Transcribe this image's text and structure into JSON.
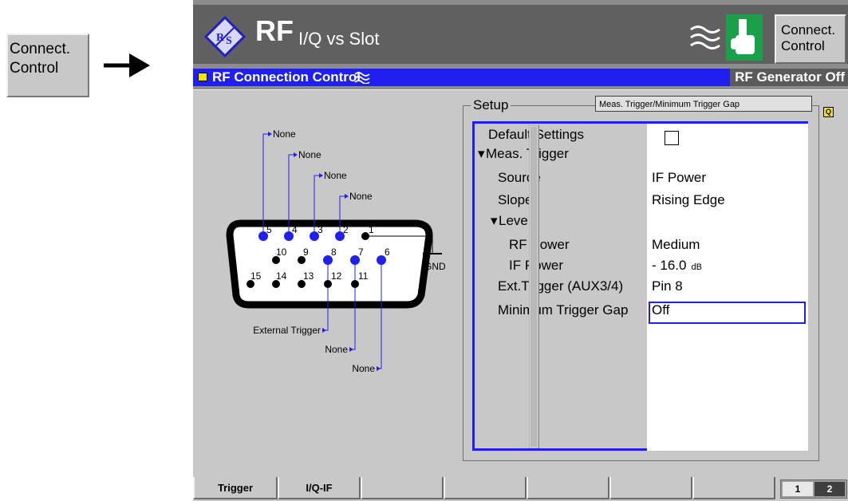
{
  "external": {
    "button_line1": "Connect.",
    "button_line2": "Control"
  },
  "title": {
    "main": "RF",
    "sub": "I/Q vs Slot"
  },
  "connect_button": {
    "line1": "Connect.",
    "line2": "Control"
  },
  "menubar": {
    "title": "RF Connection Control",
    "status": "RF Generator Off"
  },
  "setup": {
    "label": "Setup",
    "hint": "Meas. Trigger/Minimum Trigger Gap",
    "corner_icon": "Q",
    "rows": [
      {
        "label": "Default Settings",
        "value": ""
      },
      {
        "label": "Meas. Trigger",
        "value": ""
      },
      {
        "label": "Source",
        "value": "IF Power"
      },
      {
        "label": "Slope",
        "value": "Rising Edge"
      },
      {
        "label": "Level",
        "value": ""
      },
      {
        "label": "RF Power",
        "value": "Medium"
      },
      {
        "label": "IF Power",
        "value": "- 16.0",
        "unit": "dB"
      },
      {
        "label": "Ext.Trigger (AUX3/4)",
        "value": "Pin 8"
      },
      {
        "label": "Minimum Trigger Gap",
        "value": "Off"
      }
    ]
  },
  "connector": {
    "pin_numbers": [
      "5",
      "4",
      "3",
      "2",
      "1",
      "10",
      "9",
      "8",
      "7",
      "6",
      "15",
      "14",
      "13",
      "12",
      "11"
    ],
    "top_labels": [
      "None",
      "None",
      "None",
      "None"
    ],
    "bottom_labels": [
      "External Trigger",
      "None",
      "None"
    ],
    "ground_label": "GND"
  },
  "tabs": [
    {
      "label": "Trigger"
    },
    {
      "label": "I/Q-IF"
    },
    {
      "label": ""
    },
    {
      "label": ""
    },
    {
      "label": ""
    },
    {
      "label": ""
    },
    {
      "label": ""
    }
  ],
  "pager": {
    "page1": "1",
    "page2": "2"
  },
  "colors": {
    "accent_blue": "#1f1ff0",
    "panel_gray": "#c8c8c8",
    "title_gray": "#606060",
    "hand_green": "#1aa04a",
    "indicator_yellow": "#f2e400"
  }
}
